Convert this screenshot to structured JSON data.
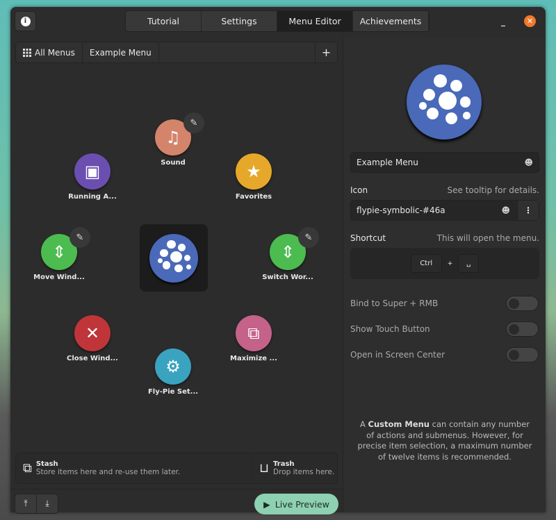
{
  "header": {
    "tabs": [
      "Tutorial",
      "Settings",
      "Menu Editor",
      "Achievements"
    ],
    "active_tab": 2
  },
  "breadcrumb": {
    "all_menus": "All Menus",
    "current": "Example Menu",
    "add": "+"
  },
  "menu": {
    "center_color": "#4a69b8",
    "items": [
      {
        "label": "Sound",
        "color": "#d4846a",
        "icon": "♫",
        "editable": true
      },
      {
        "label": "Favorites",
        "color": "#e6a82a",
        "icon": "★",
        "editable": false
      },
      {
        "label": "Switch Wor...",
        "color": "#4cbb50",
        "icon": "⇕",
        "editable": true
      },
      {
        "label": "Maximize ...",
        "color": "#c4628a",
        "icon": "⧉",
        "editable": false
      },
      {
        "label": "Fly-Pie Set...",
        "color": "#3aa3c0",
        "icon": "⚙",
        "editable": false
      },
      {
        "label": "Close Wind...",
        "color": "#c0353a",
        "icon": "✕",
        "editable": false
      },
      {
        "label": "Move Wind...",
        "color": "#4cbb50",
        "icon": "⇕",
        "editable": true
      },
      {
        "label": "Running A...",
        "color": "#6b4fb0",
        "icon": "▣",
        "editable": false
      }
    ]
  },
  "stash": {
    "title": "Stash",
    "desc": "Store items here and re-use them later."
  },
  "trash": {
    "title": "Trash",
    "desc": "Drop items here."
  },
  "live_preview": "Live Preview",
  "props": {
    "name": "Example Menu",
    "icon_label": "Icon",
    "icon_hint": "See tooltip for details.",
    "icon_value": "flypie-symbolic-#46a",
    "shortcut_label": "Shortcut",
    "shortcut_hint": "This will open the menu.",
    "key1": "Ctrl",
    "plus": "+",
    "key2": "␣",
    "toggles": [
      {
        "label": "Bind to Super + RMB",
        "on": false
      },
      {
        "label": "Show Touch Button",
        "on": false
      },
      {
        "label": "Open in Screen Center",
        "on": false
      }
    ],
    "info_bold": "Custom Menu",
    "info_pre": "A ",
    "info_post": " can contain any number of actions and submenus. However, for precise item selection, a maximum number of twelve items is recommended."
  }
}
